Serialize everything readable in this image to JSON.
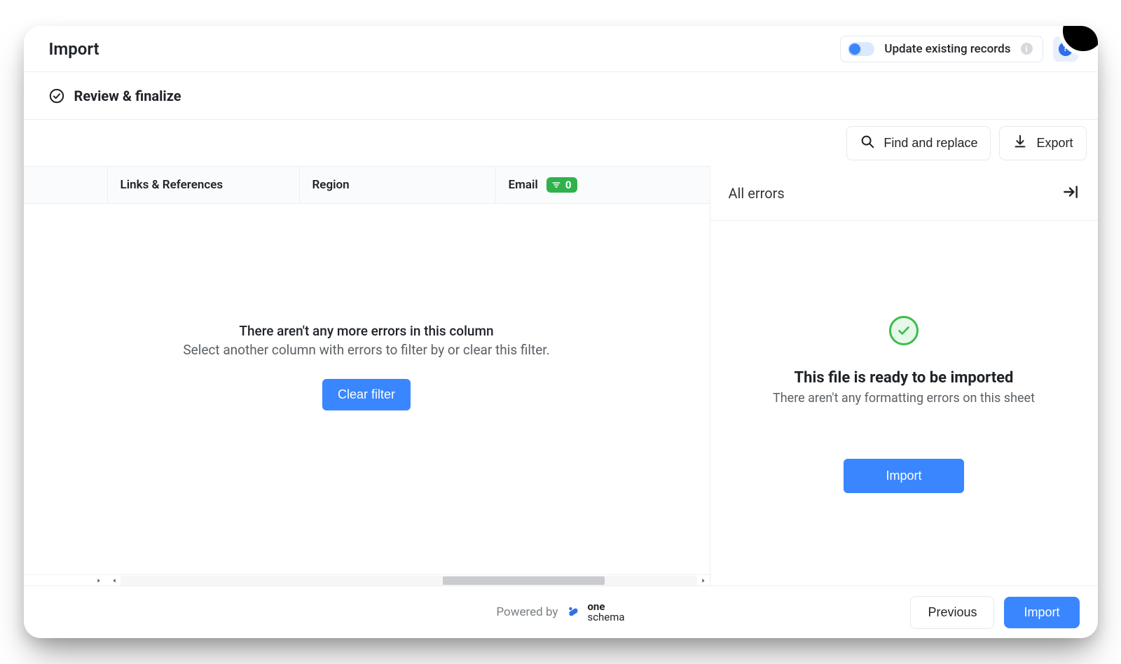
{
  "header": {
    "title": "Import",
    "update_label": "Update existing records"
  },
  "step": {
    "title": "Review & finalize"
  },
  "toolbar": {
    "find_replace": "Find and replace",
    "export": "Export"
  },
  "columns": [
    {
      "label": "Links & References"
    },
    {
      "label": "Region"
    },
    {
      "label": "Email",
      "error_count": "0"
    }
  ],
  "empty": {
    "line1": "There aren't any more errors in this column",
    "line2": "Select another column with errors to filter by or clear this filter.",
    "clear_filter": "Clear filter"
  },
  "errors_pane": {
    "header": "All errors",
    "ready_title": "This file is ready to be imported",
    "ready_subtitle": "There aren't any formatting errors on this sheet",
    "import_label": "Import"
  },
  "footer": {
    "powered_by": "Powered by",
    "brand1": "one",
    "brand2": "schema",
    "previous": "Previous",
    "import": "Import"
  }
}
